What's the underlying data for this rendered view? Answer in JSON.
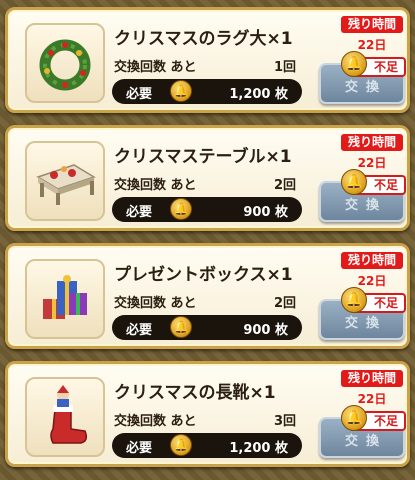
{
  "labels": {
    "exchange_count": "交換回数 あと",
    "required": "必要",
    "remaining_time": "残り時間",
    "exchange_button": "交換",
    "insufficient": "不足"
  },
  "items": [
    {
      "name": "クリスマスのラグ大×1",
      "count": "1回",
      "cost": "1,200 枚",
      "days": "22日",
      "icon": "wreath-icon"
    },
    {
      "name": "クリスマステーブル×1",
      "count": "2回",
      "cost": "900 枚",
      "days": "22日",
      "icon": "table-icon"
    },
    {
      "name": "プレゼントボックス×1",
      "count": "2回",
      "cost": "900 枚",
      "days": "22日",
      "icon": "gift-boxes-icon"
    },
    {
      "name": "クリスマスの長靴×1",
      "count": "3回",
      "cost": "1,200 枚",
      "days": "22日",
      "icon": "christmas-boot-icon"
    }
  ],
  "colors": {
    "accent_red": "#e31a1a",
    "card_border": "#c9a24a",
    "button": "#7f96ab"
  }
}
